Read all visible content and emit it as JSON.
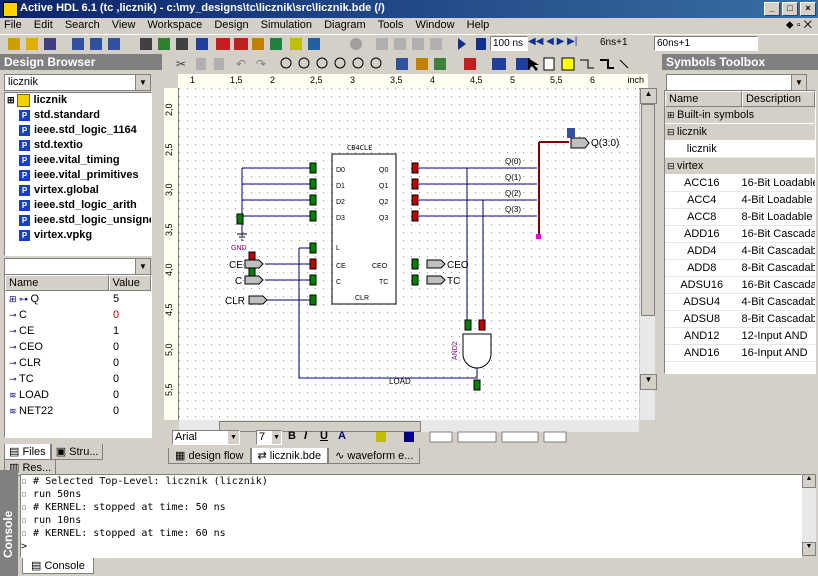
{
  "window": {
    "title": "Active HDL 6.1 (tc ,licznik) - c:\\my_designs\\tc\\licznik\\src\\licznik.bde (/)"
  },
  "menu": [
    "File",
    "Edit",
    "Search",
    "View",
    "Workspace",
    "Design",
    "Simulation",
    "Diagram",
    "Tools",
    "Window",
    "Help"
  ],
  "toolbar": {
    "sim_time": "100 ns",
    "step_label": "6ns+1",
    "time_readout": "60ns+1"
  },
  "design_browser": {
    "title": "Design Browser",
    "selected": "licznik",
    "items": [
      {
        "label": "licznik"
      },
      {
        "label": "std.standard"
      },
      {
        "label": "ieee.std_logic_1164"
      },
      {
        "label": "std.textio"
      },
      {
        "label": "ieee.vital_timing"
      },
      {
        "label": "ieee.vital_primitives"
      },
      {
        "label": "virtex.global"
      },
      {
        "label": "ieee.std_logic_arith"
      },
      {
        "label": "ieee.std_logic_unsigned"
      },
      {
        "label": "virtex.vpkg"
      }
    ],
    "signals_header": {
      "name": "Name",
      "value": "Value"
    },
    "signals": [
      {
        "name": "Q",
        "value": "5"
      },
      {
        "name": "C",
        "value": "0"
      },
      {
        "name": "CE",
        "value": "1"
      },
      {
        "name": "CEO",
        "value": "0"
      },
      {
        "name": "CLR",
        "value": "0"
      },
      {
        "name": "TC",
        "value": "0"
      },
      {
        "name": "LOAD",
        "value": "0"
      },
      {
        "name": "NET22",
        "value": "0"
      }
    ],
    "tabs": [
      "Files",
      "Stru...",
      "Res..."
    ]
  },
  "editor": {
    "ruler_unit": "inch",
    "ruler_ticks": [
      "1",
      "1,5",
      "2",
      "2,5",
      "3",
      "3,5",
      "4",
      "4,5",
      "5",
      "5,5",
      "6"
    ],
    "vruler_ticks": [
      "2,0",
      "2,5",
      "3,0",
      "3,5",
      "4,0",
      "4,5",
      "5,0",
      "5,5"
    ],
    "font_name": "Arial",
    "font_size": "7",
    "format_buttons": [
      "B",
      "I",
      "U",
      "A"
    ],
    "tabs": [
      "design flow",
      "licznik.bde",
      "waveform e..."
    ],
    "schematic": {
      "component": "CB4CLE",
      "inputs": [
        "D0",
        "D1",
        "D2",
        "D3",
        "L",
        "CE",
        "C",
        "CLR"
      ],
      "outputs": [
        "Q0",
        "Q1",
        "Q2",
        "Q3",
        "CEO",
        "TC"
      ],
      "gnd": "GND",
      "and_gate": "AND2",
      "net_load": "LOAD",
      "ports_in": [
        "CE",
        "C",
        "CLR"
      ],
      "ports_out": [
        "CEO",
        "TC"
      ],
      "bus_port": "Q(3:0)",
      "bus_taps": [
        "Q(0)",
        "Q(1)",
        "Q(2)",
        "Q(3)"
      ]
    }
  },
  "symbols_toolbox": {
    "title": "Symbols Toolbox",
    "columns": [
      "Name",
      "Description"
    ],
    "groups": [
      {
        "label": "Built-in symbols",
        "items": []
      },
      {
        "label": "licznik",
        "items": [
          {
            "name": "licznik",
            "desc": ""
          }
        ]
      },
      {
        "label": "virtex",
        "items": [
          {
            "name": "ACC16",
            "desc": "16-Bit Loadable"
          },
          {
            "name": "ACC4",
            "desc": "4-Bit Loadable"
          },
          {
            "name": "ACC8",
            "desc": "8-Bit Loadable"
          },
          {
            "name": "ADD16",
            "desc": "16-Bit Cascadab"
          },
          {
            "name": "ADD4",
            "desc": "4-Bit Cascadab"
          },
          {
            "name": "ADD8",
            "desc": "8-Bit Cascadab"
          },
          {
            "name": "ADSU16",
            "desc": "16-Bit Cascadab"
          },
          {
            "name": "ADSU4",
            "desc": "4-Bit Cascadab"
          },
          {
            "name": "ADSU8",
            "desc": "8-Bit Cascadab"
          },
          {
            "name": "AND12",
            "desc": "12-Input AND"
          },
          {
            "name": "AND16",
            "desc": "16-Input AND"
          }
        ]
      }
    ]
  },
  "console": {
    "title": "Console",
    "lines": [
      "# Selected Top-Level: licznik (licznik)",
      "run 50ns",
      "# KERNEL: stopped at time: 50 ns",
      "run 10ns",
      "# KERNEL: stopped at time: 60 ns"
    ],
    "prompt": ">",
    "tab": "Console"
  },
  "colors": {
    "titlebar": "#0a246a",
    "panel": "#d4d0c8",
    "wire": "#000080",
    "pin_green": "#008000",
    "pin_red": "#c00000"
  }
}
